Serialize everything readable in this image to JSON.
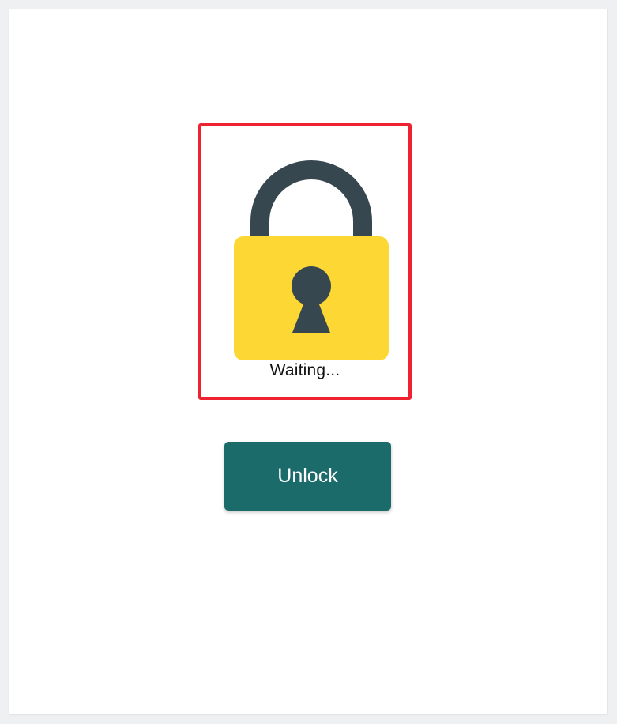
{
  "lock": {
    "status_text": "Waiting...",
    "icon": "padlock-icon",
    "state": "locked",
    "colors": {
      "frame": "#ee2230",
      "shackle": "#37474f",
      "body": "#fdd835",
      "keyhole": "#37474f"
    }
  },
  "actions": {
    "unlock_label": "Unlock",
    "button_color": "#1b6b6a"
  }
}
